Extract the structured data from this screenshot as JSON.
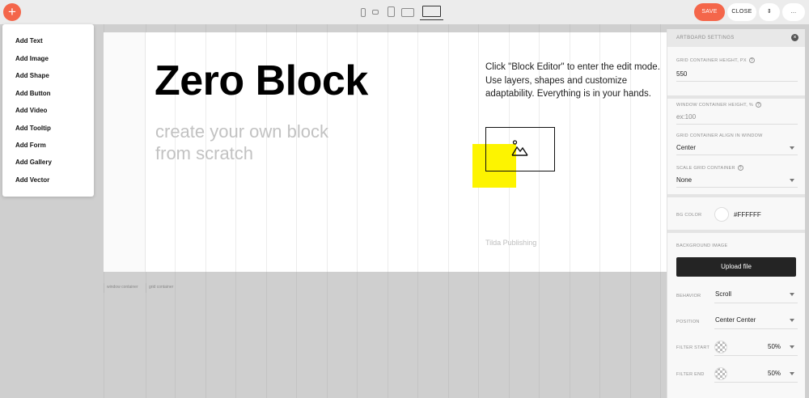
{
  "toolbar": {
    "add_label": "+",
    "save_label": "SAVE",
    "close_label": "CLOSE",
    "sort_label": "⇕",
    "more_label": "..."
  },
  "add_menu": {
    "items": [
      "Add Text",
      "Add Image",
      "Add Shape",
      "Add Button",
      "Add Video",
      "Add Tooltip",
      "Add Form",
      "Add Gallery",
      "Add Vector"
    ]
  },
  "canvas": {
    "title": "Zero Block",
    "subtitle": "create your own block from scratch",
    "description": "Click \"Block Editor\" to enter the edit mode. Use layers, shapes and customize adaptability. Everything is in your hands.",
    "credit": "Tilda Publishing",
    "window_container_label": "window container",
    "grid_container_label": "grid container",
    "accent_color": "#fdf400"
  },
  "panel": {
    "title": "ARTBOARD SETTINGS",
    "grid_height_label": "GRID CONTAINER HEIGHT, PX",
    "grid_height_value": "550",
    "window_height_label": "WINDOW CONTAINER HEIGHT, %",
    "window_height_placeholder": "ex:100",
    "align_label": "GRID CONTAINER ALIGN IN WINDOW",
    "align_value": "Center",
    "scale_label": "SCALE GRID CONTAINER",
    "scale_value": "None",
    "bg_color_label": "BG COLOR",
    "bg_color_value": "#FFFFFF",
    "bg_image_label": "BACKGROUND IMAGE",
    "upload_label": "Upload file",
    "behavior_label": "BEHAVIOR",
    "behavior_value": "Scroll",
    "position_label": "POSITION",
    "position_value": "Center Center",
    "filter_start_label": "FILTER START",
    "filter_start_value": "50%",
    "filter_end_label": "FILTER END",
    "filter_end_value": "50%"
  },
  "colors": {
    "brand": "#f4664a",
    "upload_button": "#242424"
  },
  "icons": [
    "plus-icon",
    "phone-icon",
    "phone-landscape-icon",
    "tablet-icon",
    "tablet-landscape-icon",
    "desktop-icon",
    "close-icon",
    "help-icon",
    "chevron-down-icon",
    "image-icon"
  ]
}
